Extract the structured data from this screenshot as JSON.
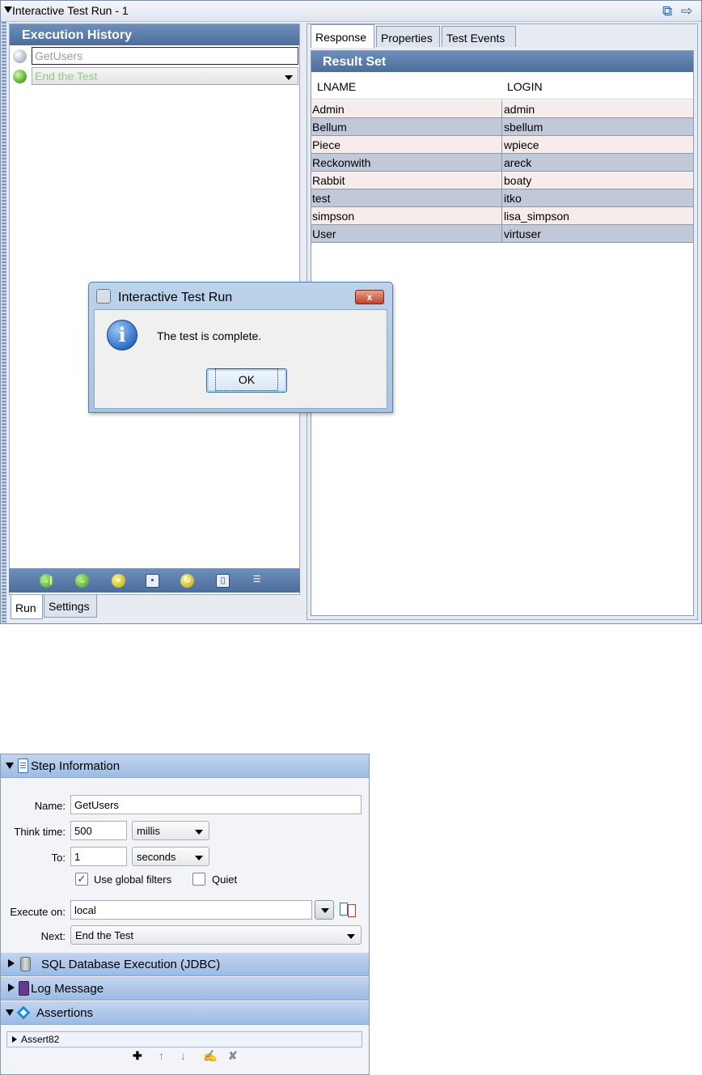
{
  "top_window": {
    "title": "Interactive Test Run - 1",
    "title_icons": [
      "restore-icon",
      "arrow-right-icon"
    ]
  },
  "execution_history": {
    "header": "Execution History",
    "steps": [
      {
        "name": "GetUsers",
        "status_color": "#b8bfcc"
      },
      {
        "name": "End the Test",
        "status_color": "#5db338"
      }
    ],
    "toolbar_icons": [
      "step-into-icon",
      "run-icon",
      "rewind-icon",
      "save-icon",
      "replay-icon",
      "delete-icon",
      "checklist-icon"
    ],
    "tabs": [
      "Run",
      "Settings"
    ]
  },
  "response_panel": {
    "tabs": [
      "Response",
      "Properties",
      "Test Events"
    ],
    "result_header": "Result Set",
    "columns": [
      "LNAME",
      "LOGIN"
    ],
    "rows": [
      [
        "Admin",
        "admin"
      ],
      [
        "Bellum",
        "sbellum"
      ],
      [
        "Piece",
        "wpiece"
      ],
      [
        "Reckonwith",
        "areck"
      ],
      [
        "Rabbit",
        "boaty"
      ],
      [
        "test",
        "itko"
      ],
      [
        "simpson",
        "lisa_simpson"
      ],
      [
        "User",
        "virtuser"
      ]
    ],
    "row_colors": {
      "odd": "#f6ecec",
      "even": "#c1c8d8"
    }
  },
  "dialog": {
    "title": "Interactive Test Run",
    "close_label": "x",
    "message": "The test is complete.",
    "ok_label": "OK"
  },
  "step_info": {
    "header": "Step Information",
    "name_label": "Name:",
    "name_value": "GetUsers",
    "think_label": "Think time:",
    "think_value": "500",
    "think_unit": "millis",
    "to_label": "To:",
    "to_value": "1",
    "to_unit": "seconds",
    "use_global_filters": {
      "label": "Use global filters",
      "checked": true
    },
    "quiet": {
      "label": "Quiet",
      "checked": false
    },
    "execute_label": "Execute on:",
    "execute_value": "local",
    "next_label": "Next:",
    "next_value": "End the Test"
  },
  "sections": {
    "sql": "SQL Database Execution (JDBC)",
    "log": "Log Message",
    "assertions": "Assertions"
  },
  "assertions": {
    "items": [
      "Assert82"
    ],
    "toolbar_icons": [
      "add-icon",
      "move-up-icon",
      "move-down-icon",
      "edit-icon",
      "delete-icon"
    ]
  }
}
